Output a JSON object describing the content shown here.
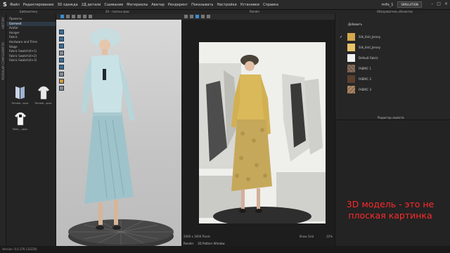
{
  "app": {
    "logo": "S"
  },
  "menu": [
    "Файл",
    "Редактирование",
    "3D одежда",
    "2Д детали",
    "Сшивание",
    "Материалы",
    "Аватар",
    "Рендеринг",
    "Показывать",
    "Настройки",
    "Установки",
    "Справка"
  ],
  "user": {
    "name": "mifo_1",
    "mode_button": "SIMULATION"
  },
  "panels": {
    "library": "Библиотека",
    "file": "20 - платье.zpac",
    "render": "Render",
    "object_browser": "Обозреватель объектов",
    "property_editor": "Редактор свойств"
  },
  "left_strip": {
    "tab1": "HISTORY",
    "tab2": "MODULAR CONFIGURATOR"
  },
  "library": {
    "items": [
      "Проекты",
      "Garment",
      "Avatar",
      "Hanger",
      "Fabric",
      "Hardware and Trims",
      "Stage",
      "Fabric Swatch(4+1)",
      "Fabric Swatch(4+2)",
      "Fabric Swatch(4+3)"
    ],
    "active_index": 1,
    "tiles": [
      {
        "label": "Female...zpac",
        "icon": "female-garment-icon"
      },
      {
        "label": "Male_...zpac",
        "icon": "male-garment-icon"
      },
      {
        "label": "Female...zpac",
        "icon": "shirt-icon"
      }
    ]
  },
  "render_status": {
    "size": "2000 x 3000 Pixels",
    "show_grid": "Show Grid",
    "zoom": "22%"
  },
  "render_tabs": [
    "Render",
    "2D Pattern Window"
  ],
  "object_browser": {
    "add_label": "Добавить",
    "fabrics": [
      {
        "name": "Silk_Knit_Jersey",
        "color": "#d4a84e",
        "checked": true
      },
      {
        "name": "Silk_Knit_Jersey",
        "color": "#e8c46a",
        "checked": false
      },
      {
        "name": "Default Fabric",
        "color": "#f2f2f2",
        "checked": false
      },
      {
        "name": "FABRIC 1",
        "color": "#8a7060",
        "checked": false
      },
      {
        "name": "FABRIC 2",
        "color": "#5a3f2e",
        "checked": false
      },
      {
        "name": "FABRIC 3",
        "color": "#b08a6a",
        "checked": false
      }
    ]
  },
  "caption": {
    "line1": "3D модель - это не",
    "line2": "плоская картинка"
  },
  "status_bar": "Version: 6.0.376 (33226)"
}
